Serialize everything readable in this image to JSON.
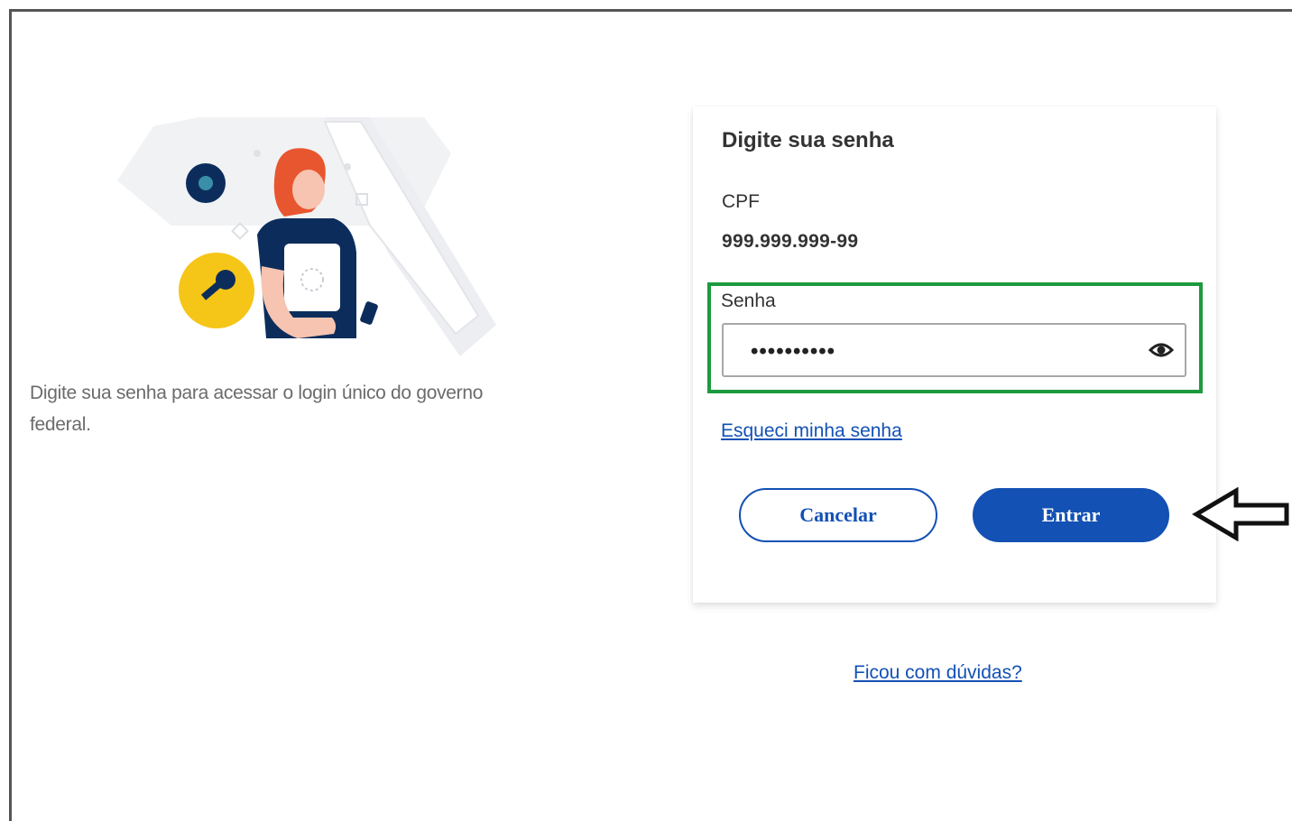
{
  "intro": {
    "text": "Digite sua senha para acessar o login único do governo federal."
  },
  "card": {
    "title": "Digite sua senha",
    "cpf_label": "CPF",
    "cpf_value": "999.999.999-99",
    "password_label": "Senha",
    "password_value": "••••••••••",
    "forgot_link": "Esqueci minha senha",
    "cancel_label": "Cancelar",
    "enter_label": "Entrar"
  },
  "help_link": "Ficou com dúvidas?",
  "icons": {
    "password_toggle": "eye-icon",
    "key": "key-icon",
    "annotation_arrow": "arrow-left-icon"
  },
  "colors": {
    "primary_blue": "#1351b4",
    "highlight_green": "#1e9a3e",
    "key_circle_yellow": "#f5c518",
    "lock_circle_navy": "#0c2d5c"
  }
}
